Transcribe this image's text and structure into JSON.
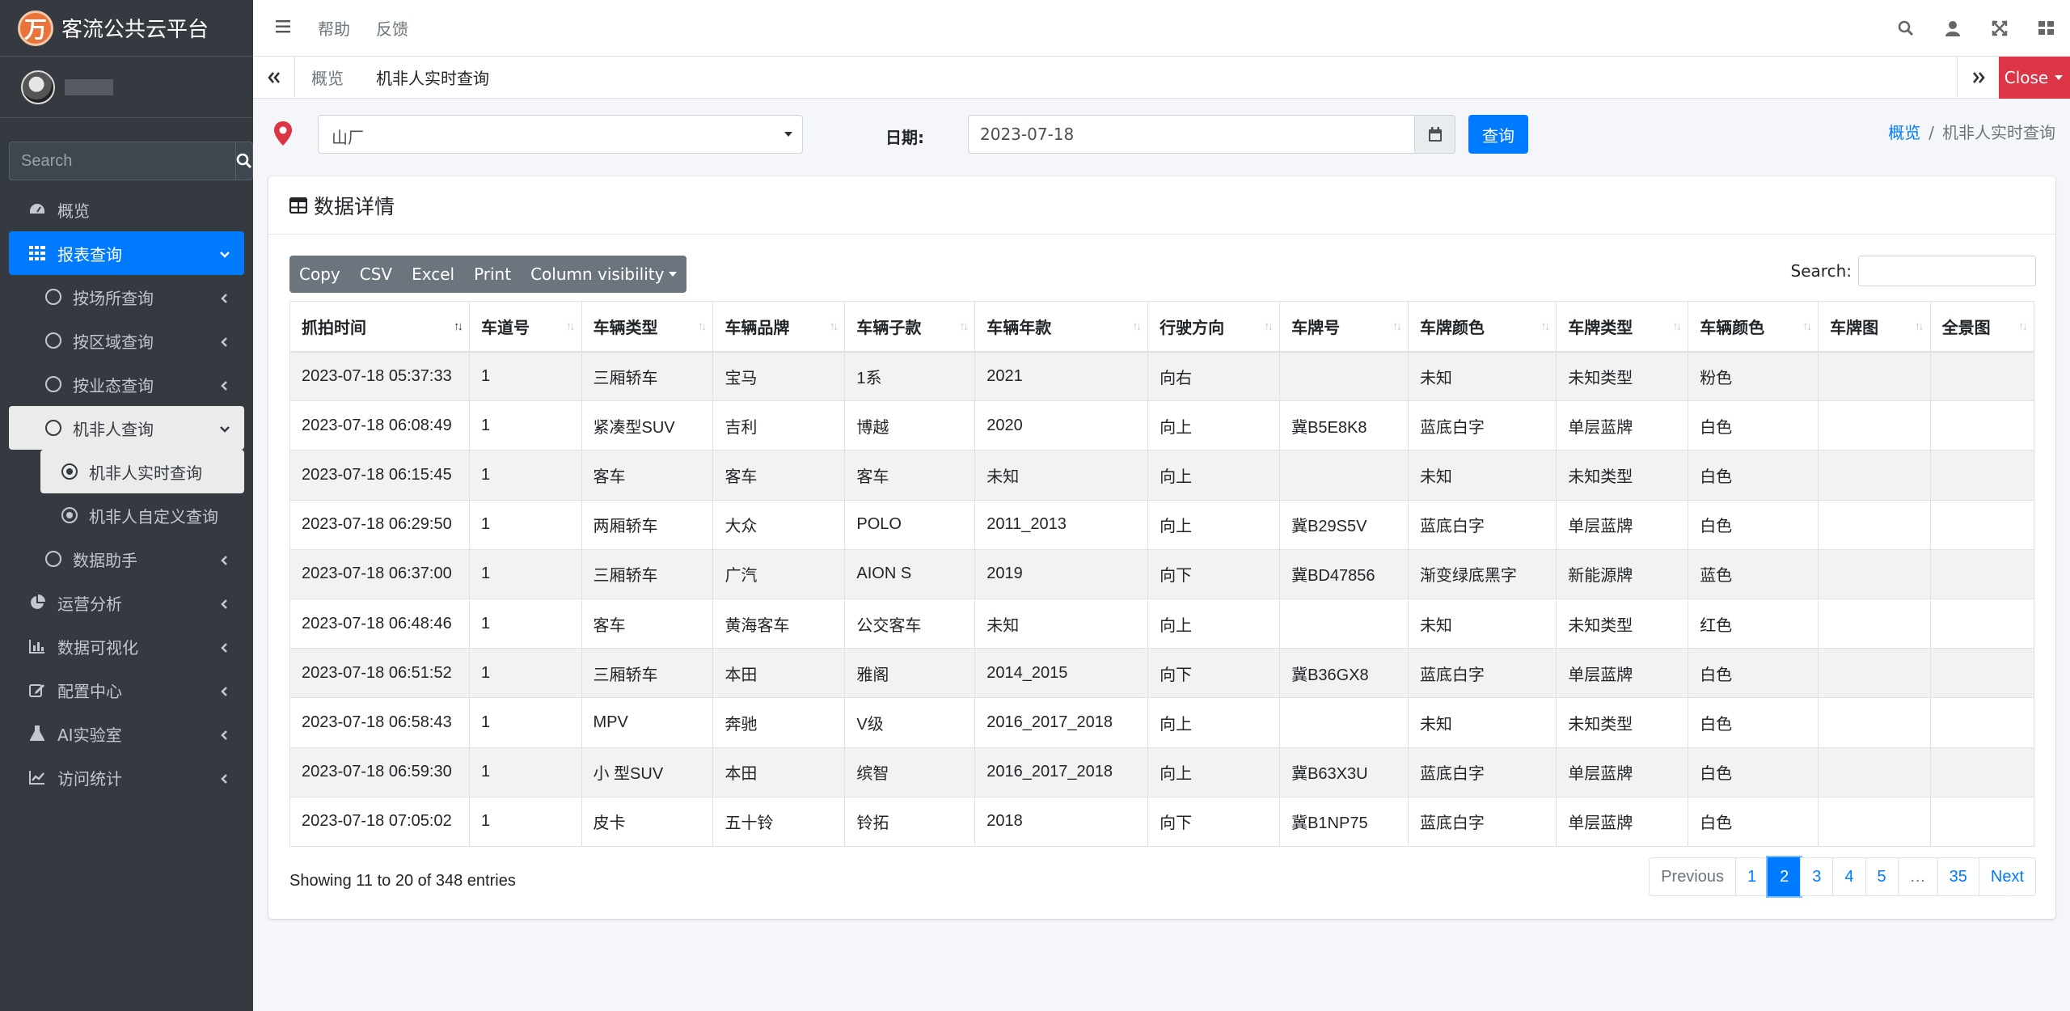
{
  "brand": {
    "logo_glyph": "万",
    "title": "客流公共云平台"
  },
  "sidebar": {
    "search_placeholder": "Search",
    "items": [
      {
        "label": "概览",
        "icon": "dashboard-icon"
      },
      {
        "label": "报表查询",
        "icon": "grid-icon",
        "active": true
      },
      {
        "label": "按场所查询"
      },
      {
        "label": "按区域查询"
      },
      {
        "label": "按业态查询"
      },
      {
        "label": "机非人查询"
      },
      {
        "label": "机非人实时查询"
      },
      {
        "label": "机非人自定义查询"
      },
      {
        "label": "数据助手"
      },
      {
        "label": "运营分析",
        "icon": "pie-chart-icon"
      },
      {
        "label": "数据可视化",
        "icon": "bar-chart-icon"
      },
      {
        "label": "配置中心",
        "icon": "edit-icon"
      },
      {
        "label": "AI实验室",
        "icon": "flask-icon"
      },
      {
        "label": "访问统计",
        "icon": "line-chart-icon"
      }
    ]
  },
  "topbar": {
    "help": "帮助",
    "feedback": "反馈"
  },
  "tabs": {
    "overview": "概览",
    "current": "机非人实时查询",
    "close": "Close"
  },
  "filter": {
    "location": "山厂",
    "date_label": "日期:",
    "date_value": "2023-07-18",
    "query_button": "查询"
  },
  "breadcrumb": {
    "home": "概览",
    "sep": "/",
    "current": "机非人实时查询"
  },
  "card": {
    "title": "数据详情"
  },
  "export_buttons": {
    "copy": "Copy",
    "csv": "CSV",
    "excel": "Excel",
    "print": "Print",
    "colvis": "Column visibility"
  },
  "table_search_label": "Search:",
  "table": {
    "headers": [
      "抓拍时间",
      "车道号",
      "车辆类型",
      "车辆品牌",
      "车辆子款",
      "车辆年款",
      "行驶方向",
      "车牌号",
      "车牌颜色",
      "车牌类型",
      "车辆颜色",
      "车牌图",
      "全景图"
    ],
    "rows": [
      [
        "2023-07-18 05:37:33",
        "1",
        "三厢轿车",
        "宝马",
        "1系",
        "2021",
        "向右",
        "",
        "未知",
        "未知类型",
        "粉色",
        "",
        ""
      ],
      [
        "2023-07-18 06:08:49",
        "1",
        "紧凑型SUV",
        "吉利",
        "博越",
        "2020",
        "向上",
        "冀B5E8K8",
        "蓝底白字",
        "单层蓝牌",
        "白色",
        "",
        ""
      ],
      [
        "2023-07-18 06:15:45",
        "1",
        "客车",
        "客车",
        "客车",
        "未知",
        "向上",
        "",
        "未知",
        "未知类型",
        "白色",
        "",
        ""
      ],
      [
        "2023-07-18 06:29:50",
        "1",
        "两厢轿车",
        "大众",
        "POLO",
        "2011_2013",
        "向上",
        "冀B29S5V",
        "蓝底白字",
        "单层蓝牌",
        "白色",
        "",
        ""
      ],
      [
        "2023-07-18 06:37:00",
        "1",
        "三厢轿车",
        "广汽",
        "AION S",
        "2019",
        "向下",
        "冀BD47856",
        "渐变绿底黑字",
        "新能源牌",
        "蓝色",
        "",
        ""
      ],
      [
        "2023-07-18 06:48:46",
        "1",
        "客车",
        "黄海客车",
        "公交客车",
        "未知",
        "向上",
        "",
        "未知",
        "未知类型",
        "红色",
        "",
        ""
      ],
      [
        "2023-07-18 06:51:52",
        "1",
        "三厢轿车",
        "本田",
        "雅阁",
        "2014_2015",
        "向下",
        "冀B36GX8",
        "蓝底白字",
        "单层蓝牌",
        "白色",
        "",
        ""
      ],
      [
        "2023-07-18 06:58:43",
        "1",
        "MPV",
        "奔驰",
        "V级",
        "2016_2017_2018",
        "向上",
        "",
        "未知",
        "未知类型",
        "白色",
        "",
        ""
      ],
      [
        "2023-07-18 06:59:30",
        "1",
        "小 型SUV",
        "本田",
        "缤智",
        "2016_2017_2018",
        "向上",
        "冀B63X3U",
        "蓝底白字",
        "单层蓝牌",
        "白色",
        "",
        ""
      ],
      [
        "2023-07-18 07:05:02",
        "1",
        "皮卡",
        "五十铃",
        "铃拓",
        "2018",
        "向下",
        "冀B1NP75",
        "蓝底白字",
        "单层蓝牌",
        "白色",
        "",
        ""
      ]
    ]
  },
  "table_info": "Showing 11 to 20 of 348 entries",
  "pagination": {
    "previous": "Previous",
    "pages": [
      "1",
      "2",
      "3",
      "4",
      "5",
      "…",
      "35"
    ],
    "current": "2",
    "next": "Next"
  },
  "colors": {
    "primary": "#007bff",
    "danger": "#dc3545",
    "sidebar": "#343a40",
    "pin": "#dc3545"
  }
}
